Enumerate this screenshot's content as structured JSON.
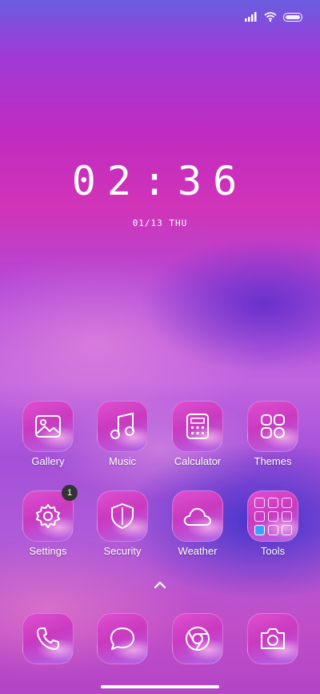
{
  "status": {
    "signal_icon": "signal-icon",
    "wifi_icon": "wifi-icon",
    "battery_icon": "battery-icon"
  },
  "clock": {
    "time": "02:36",
    "date": "01/13 THU"
  },
  "apps_row1": [
    {
      "label": "Gallery",
      "icon": "gallery-icon"
    },
    {
      "label": "Music",
      "icon": "music-icon"
    },
    {
      "label": "Calculator",
      "icon": "calculator-icon"
    },
    {
      "label": "Themes",
      "icon": "themes-icon"
    }
  ],
  "apps_row2": [
    {
      "label": "Settings",
      "icon": "gear-icon",
      "badge": "1"
    },
    {
      "label": "Security",
      "icon": "shield-icon"
    },
    {
      "label": "Weather",
      "icon": "cloud-icon"
    },
    {
      "label": "Tools",
      "icon": "folder-icon"
    }
  ],
  "dock": [
    {
      "icon": "phone-icon"
    },
    {
      "icon": "message-icon"
    },
    {
      "icon": "browser-icon"
    },
    {
      "icon": "camera-icon"
    }
  ],
  "colors": {
    "accent": "#c93ac0",
    "badge": "#333333"
  }
}
